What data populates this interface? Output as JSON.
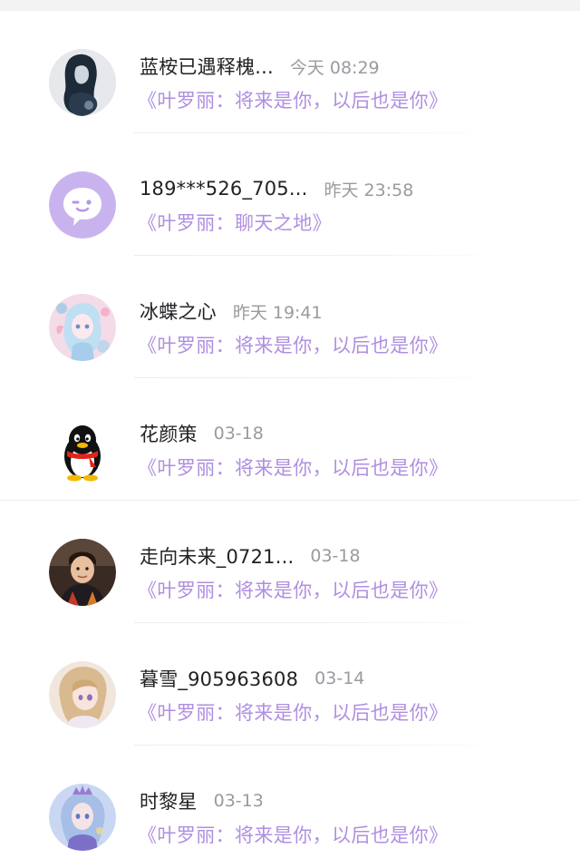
{
  "colors": {
    "accent_purple": "#b08fe0",
    "name_text": "#222226",
    "time_text": "#9a9aa0",
    "divider": "#ededef"
  },
  "conversations": [
    {
      "name": "蓝桉已遇释槐...",
      "time": "今天 08:29",
      "preview": "《叶罗丽：将来是你，以后也是你》",
      "avatar_icon": "anime-girl-dark-hair-avatar"
    },
    {
      "name": "189***526_705...",
      "time": "昨天 23:58",
      "preview": "《叶罗丽：聊天之地》",
      "avatar_icon": "chat-bubble-wink-icon"
    },
    {
      "name": "冰蝶之心",
      "time": "昨天 19:41",
      "preview": "《叶罗丽：将来是你，以后也是你》",
      "avatar_icon": "anime-girl-butterfly-avatar"
    },
    {
      "name": "花颜策",
      "time": "03-18",
      "preview": "《叶罗丽：将来是你，以后也是你》",
      "avatar_icon": "qq-penguin-icon"
    },
    {
      "name": "走向未来_0721...",
      "time": "03-18",
      "preview": "《叶罗丽：将来是你，以后也是你》",
      "avatar_icon": "boy-photo-avatar"
    },
    {
      "name": "暮雪_905963608",
      "time": "03-14",
      "preview": "《叶罗丽：将来是你，以后也是你》",
      "avatar_icon": "anime-girl-blonde-avatar"
    },
    {
      "name": "时黎星",
      "time": "03-13",
      "preview": "《叶罗丽：将来是你，以后也是你》",
      "avatar_icon": "anime-girl-crown-avatar"
    }
  ]
}
